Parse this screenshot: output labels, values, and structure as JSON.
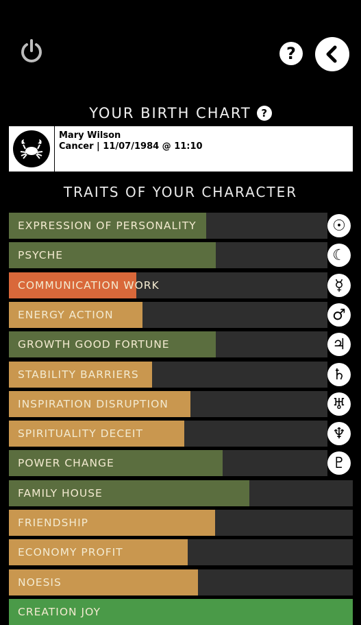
{
  "header": {
    "title": "YOUR BIRTH CHART",
    "help_glyph": "?",
    "title_help_glyph": "?"
  },
  "profile": {
    "name": "Mary Wilson",
    "details": "Cancer | 11/07/1984 @ 11:10",
    "sign_icon": "crab-icon"
  },
  "section_title": "TRAITS OF YOUR CHARACTER",
  "colors": {
    "green": "#5b6e3f",
    "orange": "#c9974f",
    "red": "#d9683a",
    "bright_green": "#4a9a48",
    "track": "#2e2e2e"
  },
  "traits": [
    {
      "label": "EXPRESSION OF PERSONALITY",
      "value": 0.62,
      "color": "green",
      "planet": "sun",
      "glyph": "☉"
    },
    {
      "label": "PSYCHE",
      "value": 0.65,
      "color": "green",
      "planet": "moon",
      "glyph": "☾"
    },
    {
      "label": "COMMUNICATION WORK",
      "value": 0.4,
      "color": "red",
      "planet": "mercury",
      "glyph": "☿"
    },
    {
      "label": "ENERGY ACTION",
      "value": 0.42,
      "color": "orange",
      "planet": "mars",
      "glyph": "♂"
    },
    {
      "label": "GROWTH GOOD FORTUNE",
      "value": 0.65,
      "color": "green",
      "planet": "jupiter",
      "glyph": "♃"
    },
    {
      "label": "STABILITY BARRIERS",
      "value": 0.45,
      "color": "orange",
      "planet": "saturn",
      "glyph": "♄"
    },
    {
      "label": "INSPIRATION DISRUPTION",
      "value": 0.57,
      "color": "orange",
      "planet": "uranus",
      "glyph": "♅"
    },
    {
      "label": "SPIRITUALITY DECEIT",
      "value": 0.55,
      "color": "orange",
      "planet": "neptune",
      "glyph": "♆"
    },
    {
      "label": "POWER CHANGE",
      "value": 0.67,
      "color": "green",
      "planet": "pluto",
      "glyph": "♇"
    },
    {
      "label": "FAMILY HOUSE",
      "value": 0.7,
      "color": "green",
      "planet": "",
      "glyph": ""
    },
    {
      "label": "FRIENDSHIP",
      "value": 0.6,
      "color": "orange",
      "planet": "",
      "glyph": ""
    },
    {
      "label": "ECONOMY PROFIT",
      "value": 0.52,
      "color": "orange",
      "planet": "",
      "glyph": ""
    },
    {
      "label": "NOESIS",
      "value": 0.55,
      "color": "orange",
      "planet": "",
      "glyph": ""
    },
    {
      "label": "CREATION JOY",
      "value": 1.0,
      "color": "bright_green",
      "planet": "",
      "glyph": ""
    }
  ]
}
